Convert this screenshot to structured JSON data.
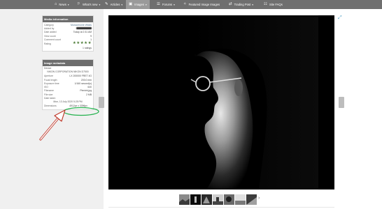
{
  "nav": {
    "items": [
      {
        "icon": "home-icon",
        "label": "News",
        "has_dropdown": true
      },
      {
        "icon": "whats-new-icon",
        "label": "What's new",
        "has_dropdown": true
      },
      {
        "icon": "articles-icon",
        "label": "Articles",
        "has_dropdown": true
      },
      {
        "icon": "images-icon",
        "label": "Images",
        "has_dropdown": true,
        "active": true
      },
      {
        "icon": "forums-icon",
        "label": "Forums",
        "has_dropdown": true
      },
      {
        "icon": "featured-icon",
        "label": "Featured Image Images",
        "has_dropdown": false
      },
      {
        "icon": "trading-post-icon",
        "label": "Trading Post",
        "has_dropdown": true
      },
      {
        "icon": "faq-icon",
        "label": "Site FAQs",
        "has_dropdown": false
      }
    ]
  },
  "media_info": {
    "title": "Media information",
    "rows": [
      {
        "key": "Category",
        "value": "Monochrome Wklds"
      },
      {
        "key": "Added by",
        "value": ""
      },
      {
        "key": "Date added",
        "value": "Today at 2:31 AM"
      },
      {
        "key": "View count",
        "value": "9"
      },
      {
        "key": "Comment count",
        "value": "1"
      },
      {
        "key": "Rating",
        "value": ""
      }
    ],
    "ratings_label": "1 ratings",
    "rating_value": 5
  },
  "image_metadata": {
    "title": "Image metadata",
    "device_label": "Device",
    "device_value": "NIKON CORPORATION NIKON D7500",
    "rows": [
      {
        "key": "Aperture",
        "value": "LX 200000 FRET 4G"
      },
      {
        "key": "Focal length",
        "value": "200.0 mm"
      },
      {
        "key": "Exposure time",
        "value": "1/160 second(s)"
      },
      {
        "key": "ISO",
        "value": "640"
      },
      {
        "key": "Filename",
        "value": "Pieniek.jpg"
      },
      {
        "key": "File size",
        "value": "2 MB"
      },
      {
        "key": "Date taken",
        "value": ""
      }
    ],
    "date_taken_value": "Mon, 13 July 2020 5:25 PM",
    "dimensions_key": "Dimensions",
    "dimensions_value": "4912px x 3396px"
  },
  "thumbnails": {
    "count": 7,
    "next_icon": "chevron-right-icon"
  },
  "colors": {
    "nav_bg": "#6f6f6f",
    "panel_head_bg": "#6d6d6d",
    "star_color": "#4a7a34",
    "highlight_circle": "#22b14c",
    "annotation_arrow": "#c0392b"
  }
}
